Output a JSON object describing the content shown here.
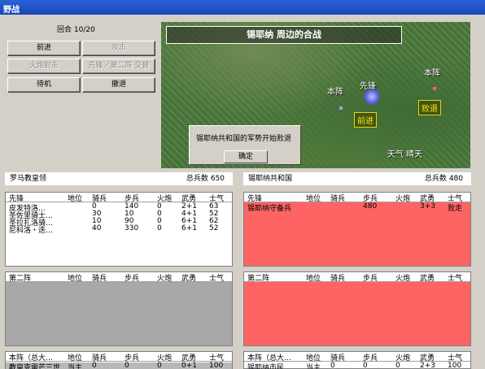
{
  "window": {
    "title": "野战"
  },
  "turn_label": "回合 10/20",
  "buttons": {
    "advance": "前进",
    "attack": "攻击",
    "fire_artillery": "火炮射击",
    "swap_lines": "先锋／第二阵 交替",
    "wait": "待机",
    "retreat": "撤退"
  },
  "map": {
    "title": "锡耶纳 周边的合战",
    "left_camp": "本阵",
    "vanguard": "先锋",
    "right_camp": "本阵",
    "left_order": "前进",
    "right_order": "败退",
    "weather": "天气  晴天"
  },
  "dialog": {
    "message": "锡耶纳共和国的军势开始败退",
    "ok": "确定"
  },
  "left_side": {
    "name": "罗马教皇领",
    "total_label": "总兵数",
    "total": "650",
    "front": {
      "header": [
        "先锋",
        "地位",
        "骑兵",
        "步兵",
        "火炮",
        "武勇",
        "士气"
      ],
      "rows": [
        [
          "皮发特洛…",
          "",
          "0",
          "140",
          "0",
          "2+1",
          "63"
        ],
        [
          "圣佐里骑士…",
          "",
          "30",
          "10",
          "0",
          "4+1",
          "52"
        ],
        [
          "圣拉扎洛骑…",
          "",
          "10",
          "90",
          "0",
          "6+1",
          "62"
        ],
        [
          "尼科洛・迭…",
          "",
          "40",
          "330",
          "0",
          "6+1",
          "52"
        ]
      ]
    },
    "second": {
      "header": [
        "第二阵",
        "地位",
        "骑兵",
        "步兵",
        "火炮",
        "武勇",
        "士气"
      ],
      "rows": []
    },
    "main": {
      "header": [
        "本阵（总大…",
        "地位",
        "骑兵",
        "步兵",
        "火炮",
        "武勇",
        "士气"
      ],
      "rows": [
        [
          "教皇克雷芒三世",
          "当主",
          "0",
          "0",
          "0",
          "0+1",
          "100"
        ]
      ]
    }
  },
  "right_side": {
    "name": "锡耶纳共和国",
    "total_label": "总兵数",
    "total": "480",
    "front": {
      "header": [
        "先锋",
        "地位",
        "骑兵",
        "步兵",
        "火炮",
        "武勇",
        "士气"
      ],
      "rows": [
        [
          "锡耶纳守备兵",
          "",
          "",
          "480",
          "",
          "3+3",
          "败走"
        ]
      ]
    },
    "second": {
      "header": [
        "第二阵",
        "地位",
        "骑兵",
        "步兵",
        "火炮",
        "武勇",
        "士气"
      ],
      "rows": []
    },
    "main": {
      "header": [
        "本阵（总大…",
        "地位",
        "骑兵",
        "步兵",
        "火炮",
        "武勇",
        "士气"
      ],
      "rows": [
        [
          "锡耶纳市民",
          "当主",
          "0",
          "0",
          "0",
          "2+3",
          "100"
        ]
      ]
    }
  },
  "colors": {
    "left_fill": "#ffffff",
    "left_gray": "#a8a8a8",
    "right_fill": "#ff6464",
    "title_bar": "#2b62d9"
  }
}
